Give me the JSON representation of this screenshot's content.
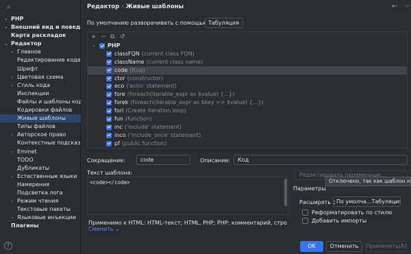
{
  "sidebar": {
    "items": [
      {
        "label": "PHP",
        "level": 0,
        "chevron": "›"
      },
      {
        "label": "Внешний вид и поведение",
        "level": 0,
        "chevron": "›"
      },
      {
        "label": "Карта раскладок",
        "level": 0,
        "chevron": ""
      },
      {
        "label": "Редактор",
        "level": 0,
        "chevron": "⌄"
      },
      {
        "label": "Главное",
        "level": 1,
        "chevron": "›"
      },
      {
        "label": "Редактирование кода",
        "level": 1,
        "chevron": ""
      },
      {
        "label": "Шрифт",
        "level": 1,
        "chevron": ""
      },
      {
        "label": "Цветовая схема",
        "level": 1,
        "chevron": "›"
      },
      {
        "label": "Стиль кода",
        "level": 1,
        "chevron": "›"
      },
      {
        "label": "Инспекции",
        "level": 1,
        "chevron": ""
      },
      {
        "label": "Файлы и шаблоны кода",
        "level": 1,
        "chevron": ""
      },
      {
        "label": "Кодировки файлов",
        "level": 1,
        "chevron": ""
      },
      {
        "label": "Живые шаблоны",
        "level": 1,
        "chevron": "",
        "selected": true
      },
      {
        "label": "Типы файлов",
        "level": 1,
        "chevron": ""
      },
      {
        "label": "Авторское право",
        "level": 1,
        "chevron": "›"
      },
      {
        "label": "Контекстные подсказки",
        "level": 1,
        "chevron": ""
      },
      {
        "label": "Emmet",
        "level": 1,
        "chevron": "›"
      },
      {
        "label": "TODO",
        "level": 1,
        "chevron": ""
      },
      {
        "label": "Дубликаты",
        "level": 1,
        "chevron": ""
      },
      {
        "label": "Естественные языки",
        "level": 1,
        "chevron": "›"
      },
      {
        "label": "Намерения",
        "level": 1,
        "chevron": ""
      },
      {
        "label": "Подсветка лога",
        "level": 1,
        "chevron": ""
      },
      {
        "label": "Режим чтения",
        "level": 1,
        "chevron": "›"
      },
      {
        "label": "Текстовые пакеты",
        "level": 1,
        "chevron": ""
      },
      {
        "label": "Языковые инъекции",
        "level": 1,
        "chevron": "›"
      },
      {
        "label": "Плагины",
        "level": 0,
        "chevron": ""
      }
    ]
  },
  "header": {
    "crumb_parent": "Редактор",
    "crumb_sep": "›",
    "crumb_current": "Живые шаблоны",
    "back_glyph": "←",
    "forward_glyph": "→"
  },
  "expand": {
    "label": "По умолчанию разворачивать с помощью",
    "value": "Табуляция"
  },
  "toolbar": {
    "add": "+",
    "remove": "−",
    "copy": "⧉",
    "restore": "↺"
  },
  "tree": {
    "group": "PHP",
    "items": [
      {
        "name": "classFQN",
        "desc": "(current class FQN)"
      },
      {
        "name": "className",
        "desc": "(current class name)"
      },
      {
        "name": "code",
        "desc": "(Код)",
        "selected": true
      },
      {
        "name": "ctor",
        "desc": "(constructor)"
      },
      {
        "name": "eco",
        "desc": "('echo' statement)"
      },
      {
        "name": "fore",
        "desc": "(foreach(iterable_expr as $value) {...})"
      },
      {
        "name": "forek",
        "desc": "(foreach(iterable_expr as $key => $value) {...})"
      },
      {
        "name": "fori",
        "desc": "(Create iteration loop)"
      },
      {
        "name": "fun",
        "desc": "(function)"
      },
      {
        "name": "inc",
        "desc": "('include' statement)"
      },
      {
        "name": "inco",
        "desc": "('include_once' statement)"
      },
      {
        "name": "pf",
        "desc": "(public function)"
      }
    ]
  },
  "form": {
    "abbr_label": "Сокращение:",
    "abbr_value": "code",
    "desc_label": "Описание:",
    "desc_value": "Код",
    "text_label": "Текст шаблона:",
    "template_text": "<code></code>",
    "edit_vars": "Редактировать переменные...",
    "tooltip": "Отключено, так как шаблон не имеет переменных",
    "params_label": "Параметры",
    "expand_with_label": "Расширять с",
    "expand_with_value": "По умолча...Табуляция)",
    "reformat_label": "Реформатировать по стилю",
    "imports_label": "Добавить импорты",
    "applicable": "Применимо к HTML: HTML-текст; HTML, PHP; PHP: комментарий, строковый литерал...",
    "change_link": "Сменить ⌄"
  },
  "buttons": {
    "ok": "OK",
    "cancel": "Отменить",
    "apply": "Применить(A)"
  },
  "colors": {
    "accent": "#3574f0",
    "selection": "#2e436e",
    "background": "#2b2d30"
  }
}
